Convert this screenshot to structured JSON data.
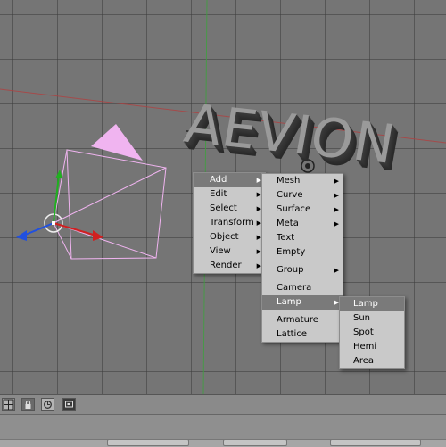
{
  "viewport": {
    "text_object": "AEVION"
  },
  "add_menu": {
    "items": [
      {
        "label": "Add"
      },
      {
        "label": "Edit"
      },
      {
        "label": "Select"
      },
      {
        "label": "Transform"
      },
      {
        "label": "Object"
      },
      {
        "label": "View"
      },
      {
        "label": "Render"
      }
    ]
  },
  "add_submenu": {
    "items": [
      {
        "label": "Mesh"
      },
      {
        "label": "Curve"
      },
      {
        "label": "Surface"
      },
      {
        "label": "Meta"
      },
      {
        "label": "Text"
      },
      {
        "label": "Empty"
      },
      {
        "label": "Group"
      },
      {
        "label": "Camera"
      },
      {
        "label": "Lamp"
      },
      {
        "label": "Armature"
      },
      {
        "label": "Lattice"
      }
    ]
  },
  "lamp_submenu": {
    "items": [
      {
        "label": "Lamp"
      },
      {
        "label": "Sun"
      },
      {
        "label": "Spot"
      },
      {
        "label": "Hemi"
      },
      {
        "label": "Area"
      }
    ]
  },
  "colors": {
    "viewport_bg": "#757575",
    "camera": "#f0b4f0",
    "x_axis": "#d02020",
    "y_axis": "#20b020",
    "z_axis": "#2050e0",
    "menu_bg": "#c9c9c9",
    "menu_active": "#7a7a7a"
  },
  "icons": {
    "viewport_toggle": "grid-icon",
    "lock": "lock-icon",
    "link": "link-icon",
    "render": "render-icon"
  }
}
